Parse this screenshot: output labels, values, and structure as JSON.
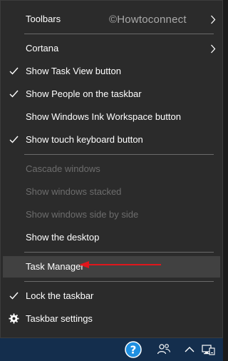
{
  "watermark": "©Howtoconnect",
  "menu": {
    "toolbars": "Toolbars",
    "cortana": "Cortana",
    "show_task_view": "Show Task View button",
    "show_people": "Show People on the taskbar",
    "show_ink": "Show Windows Ink Workspace button",
    "show_touch_keyboard": "Show touch keyboard button",
    "cascade": "Cascade windows",
    "stacked": "Show windows stacked",
    "side_by_side": "Show windows side by side",
    "show_desktop": "Show the desktop",
    "task_manager": "Task Manager",
    "lock_taskbar": "Lock the taskbar",
    "taskbar_settings": "Taskbar settings"
  },
  "colors": {
    "menu_bg": "#2b2b2b",
    "highlight": "#414141",
    "disabled_text": "#6d6d6d",
    "arrow": "#e0161c",
    "taskbar": "#142e4d",
    "help_icon": "#1e8fe1"
  },
  "icons": {
    "checkmark": "checkmark-icon",
    "chevron": "chevron-right-icon",
    "gear": "gear-icon",
    "help": "help-icon",
    "people": "people-icon",
    "chevron_up": "chevron-up-icon",
    "network": "network-icon"
  }
}
